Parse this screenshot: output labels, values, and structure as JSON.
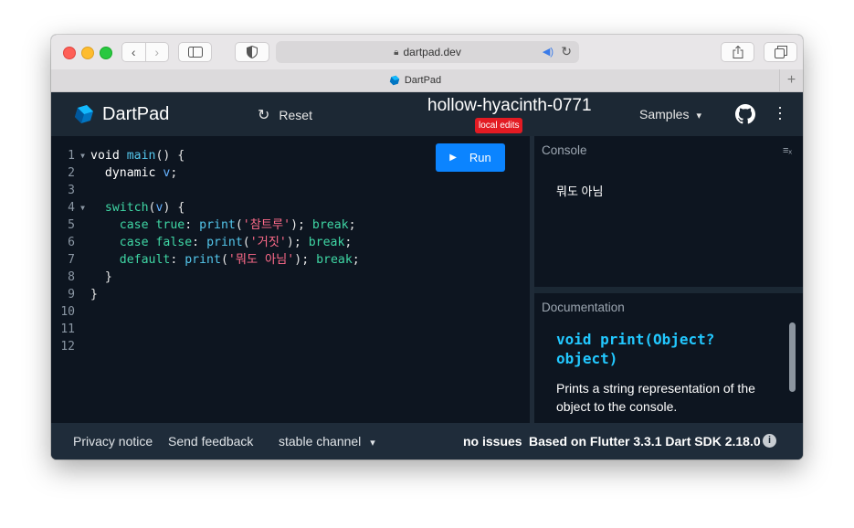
{
  "browser": {
    "url": "dartpad.dev",
    "tab_title": "DartPad",
    "new_tab_symbol": "+"
  },
  "header": {
    "logo_text": "DartPad",
    "reset_label": "Reset",
    "project_name": "hollow-hyacinth-0771",
    "badge": "local edits",
    "samples_label": "Samples"
  },
  "editor": {
    "run_label": "Run",
    "line_numbers": [
      "1",
      "2",
      "3",
      "4",
      "5",
      "6",
      "7",
      "8",
      "9",
      "10",
      "11",
      "12"
    ]
  },
  "console": {
    "label": "Console",
    "output": "뭐도 아님"
  },
  "docs": {
    "label": "Documentation",
    "signature": "void print(Object? object)",
    "body": "Prints a string representation of the object to the console."
  },
  "footer": {
    "privacy": "Privacy notice",
    "feedback": "Send feedback",
    "channel": "stable channel",
    "issues": "no issues",
    "sdk": "Based on Flutter 3.3.1 Dart SDK 2.18.0"
  },
  "colors": {
    "accent": "#0b84ff",
    "badge": "#e31b23",
    "header_bg": "#1c2834",
    "editor_bg": "#0d1520"
  }
}
